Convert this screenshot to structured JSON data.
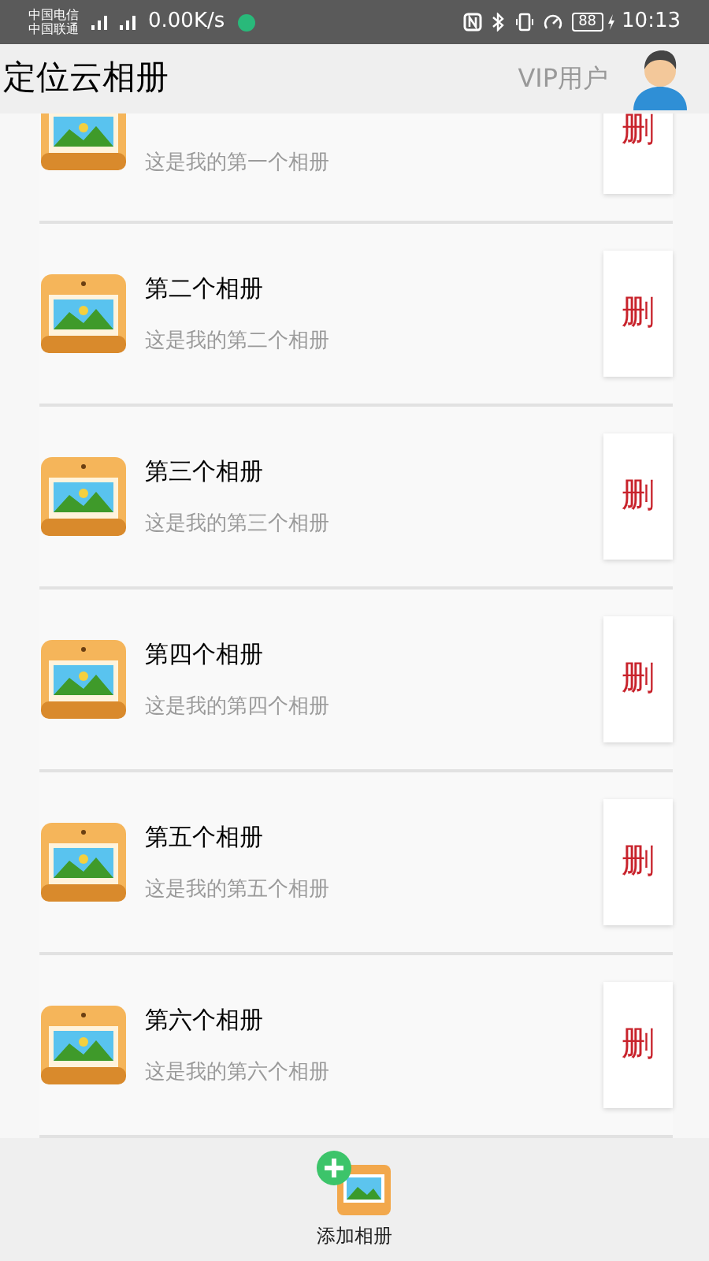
{
  "status_bar": {
    "carrier_1": "中国电信",
    "carrier_2": "中国联通",
    "speed": "0.00K/s",
    "battery": "88",
    "time": "10:13"
  },
  "header": {
    "title": "定位云相册",
    "user_label": "VIP用户"
  },
  "albums": [
    {
      "subtitle": "这是我的第一个相册",
      "delete_label": "删"
    },
    {
      "title": "第二个相册",
      "subtitle": "这是我的第二个相册",
      "delete_label": "删"
    },
    {
      "title": "第三个相册",
      "subtitle": "这是我的第三个相册",
      "delete_label": "删"
    },
    {
      "title": "第四个相册",
      "subtitle": "这是我的第四个相册",
      "delete_label": "删"
    },
    {
      "title": "第五个相册",
      "subtitle": "这是我的第五个相册",
      "delete_label": "删"
    },
    {
      "title": "第六个相册",
      "subtitle": "这是我的第六个相册",
      "delete_label": "删"
    }
  ],
  "bottom_bar": {
    "add_label": "添加相册"
  }
}
